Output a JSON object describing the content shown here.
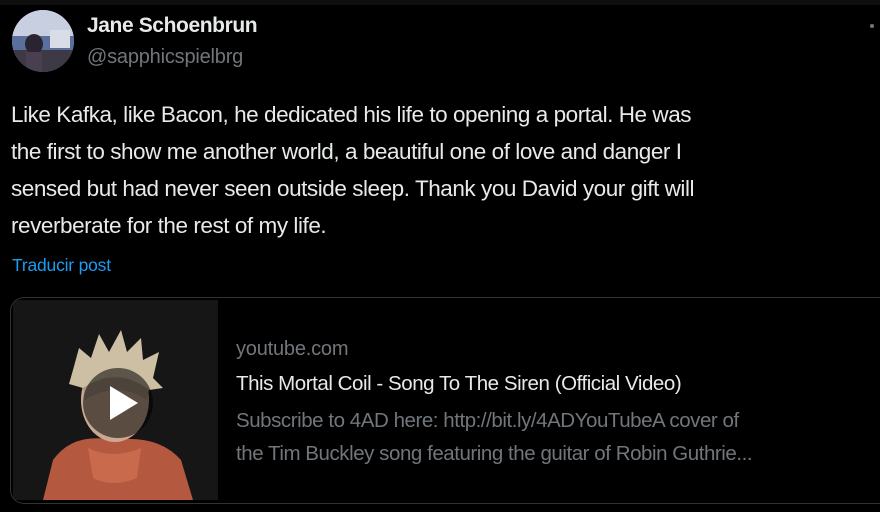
{
  "tweet": {
    "author": {
      "name": "Jane Schoenbrun",
      "handle": "@sapphicspielbrg",
      "avatar_icon": "avatar-photo"
    },
    "text_lines": [
      "Like Kafka, like Bacon, he dedicated his life to opening a portal. He was",
      "the first to show me another world, a beautiful one of love and danger I",
      "sensed but had never seen outside sleep. Thank you David your gift will",
      "reverberate for the rest of my life."
    ],
    "translate_label": "Traducir post",
    "more_icon": "more-dots-icon"
  },
  "link_card": {
    "domain": "youtube.com",
    "title": "This Mortal Coil - Song To The Siren (Official Video)",
    "description_lines": [
      "Subscribe to 4AD here: http://bit.ly/4ADYouTubeA cover of",
      "the Tim Buckley song featuring the guitar of Robin Guthrie..."
    ],
    "play_icon": "play-icon"
  },
  "colors": {
    "background": "#000000",
    "text_primary": "#e7e9ea",
    "text_secondary": "#71767b",
    "link": "#1d9bf0",
    "card_border": "#2f3336"
  }
}
